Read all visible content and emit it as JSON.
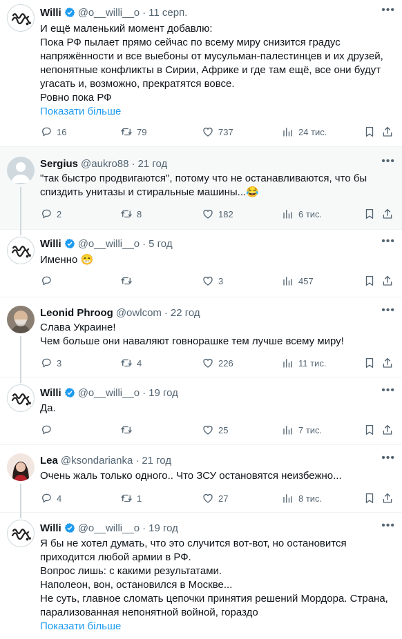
{
  "tweets": [
    {
      "name": "Willi",
      "handle": "@o__willi__o",
      "sep": "·",
      "time": "11 серп.",
      "verified": true,
      "lines": [
        "И ещё маленький момент добавлю:",
        "Пока РФ пылает прямо сейчас по всему миру снизится градус",
        "напряжённости и все выебоны от мусульман-палестинцев и их друзей,",
        "непонятные конфликты в Сирии, Африке и где там ещё, все они будут",
        "угасать и, возможно, прекратятся вовсе.",
        "Ровно пока РФ"
      ],
      "show_more": "Показати більше",
      "replies": "16",
      "retweets": "79",
      "likes": "737",
      "views": "24 тис."
    },
    {
      "name": "Sergius",
      "handle": "@aukro88",
      "sep": "·",
      "time": "21 год",
      "verified": false,
      "lines": [
        "\"так быстро продвигаются\", потому что не останавливаются, что бы",
        "спиздить унитазы и стиральные машины...😂"
      ],
      "replies": "2",
      "retweets": "8",
      "likes": "182",
      "views": "6 тис."
    },
    {
      "name": "Willi",
      "handle": "@o__willi__o",
      "sep": "·",
      "time": "5 год",
      "verified": true,
      "lines": [
        "Именно 😁"
      ],
      "replies": "",
      "retweets": "",
      "likes": "3",
      "views": "457"
    },
    {
      "name": "Leonid Phroog",
      "handle": "@owlcom",
      "sep": "·",
      "time": "22 год",
      "verified": false,
      "lines": [
        "Слава Украине!",
        "Чем больше они наваляют говнорашке тем лучше всему миру!"
      ],
      "replies": "3",
      "retweets": "4",
      "likes": "226",
      "views": "11 тис."
    },
    {
      "name": "Willi",
      "handle": "@o__willi__o",
      "sep": "·",
      "time": "19 год",
      "verified": true,
      "lines": [
        "Да."
      ],
      "replies": "",
      "retweets": "",
      "likes": "25",
      "views": "7 тис."
    },
    {
      "name": "Lea",
      "handle": "@ksondarianka",
      "sep": "·",
      "time": "21 год",
      "verified": false,
      "lines": [
        "Очень жаль только одного.. Что  ЗСУ остановятся неизбежно..."
      ],
      "replies": "4",
      "retweets": "1",
      "likes": "27",
      "views": "8 тис."
    },
    {
      "name": "Willi",
      "handle": "@o__willi__o",
      "sep": "·",
      "time": "19 год",
      "verified": true,
      "lines": [
        "Я бы не хотел думать, что это случится вот-вот, но остановится",
        "приходится любой армии в РФ.",
        "Вопрос лишь: с какими результатами.",
        "Наполеон, вон, остановился в Москве...",
        "Не суть, главное сломать цепочки принятия решений Мордора. Страна,",
        "парализованная непонятной войной, гораздо"
      ],
      "show_more": "Показати більше"
    }
  ],
  "more_icon": "more-horizontal-icon",
  "colors": {
    "verified": "#1d9bf0",
    "link": "#1d9bf0",
    "muted": "#536471",
    "highlight_bg": "#f7f9f9"
  }
}
